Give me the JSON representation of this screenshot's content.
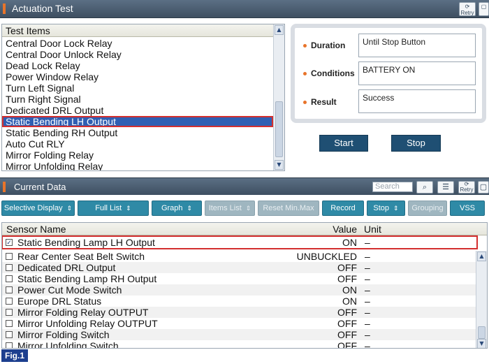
{
  "window": {
    "title": "Actuation Test",
    "retry_label": "Retry"
  },
  "test_items": {
    "header": "Test Items",
    "items": [
      "Central Door Lock Relay",
      "Central Door Unlock Relay",
      "Dead Lock Relay",
      "Power Window Relay",
      "Turn Left Signal",
      "Turn Right Signal",
      "Dedicated DRL Output",
      "Static Bending LH Output",
      "Static Bending RH Output",
      "Auto Cut RLY",
      "Mirror Folding Relay",
      "Mirror Unfolding Relay"
    ],
    "selected_index": 7
  },
  "details": {
    "duration_label": "Duration",
    "duration_value": "Until Stop Button",
    "conditions_label": "Conditions",
    "conditions_value": "BATTERY ON",
    "result_label": "Result",
    "result_value": "Success"
  },
  "actions": {
    "start_label": "Start",
    "stop_label": "Stop"
  },
  "current_data": {
    "title": "Current Data",
    "search_placeholder": "Search",
    "retry_label": "Retry"
  },
  "toolbar": {
    "selective_display": "Selective Display",
    "full_list": "Full List",
    "graph": "Graph",
    "items_list": "Items List",
    "reset_min_max": "Reset Min.Max",
    "record": "Record",
    "stop": "Stop",
    "grouping": "Grouping",
    "vss": "VSS"
  },
  "table": {
    "col_sensor": "Sensor Name",
    "col_value": "Value",
    "col_unit": "Unit",
    "pinned_row": {
      "name": "Static Bending Lamp LH Output",
      "value": "ON",
      "unit": "–",
      "checked": true
    },
    "rows": [
      {
        "name": "Rear Center Seat Belt Switch",
        "value": "UNBUCKLED",
        "unit": "–"
      },
      {
        "name": "Dedicated DRL Output",
        "value": "OFF",
        "unit": "–"
      },
      {
        "name": "Static Bending Lamp RH Output",
        "value": "OFF",
        "unit": "–"
      },
      {
        "name": "Power Cut Mode Switch",
        "value": "ON",
        "unit": "–"
      },
      {
        "name": "Europe DRL Status",
        "value": "ON",
        "unit": "–"
      },
      {
        "name": "Mirror Folding Relay OUTPUT",
        "value": "OFF",
        "unit": "–"
      },
      {
        "name": "Mirror Unfolding Relay OUTPUT",
        "value": "OFF",
        "unit": "–"
      },
      {
        "name": "Mirror Folding Switch",
        "value": "OFF",
        "unit": "–"
      },
      {
        "name": "Mirror Unfolding Switch",
        "value": "OFF",
        "unit": "–"
      }
    ]
  },
  "figure_label": "Fig.1",
  "colors": {
    "accent_orange": "#e8742a",
    "button_navy": "#1f4f73",
    "toolbar_teal": "#2f8aa6",
    "highlight_red": "#d32f2f"
  }
}
